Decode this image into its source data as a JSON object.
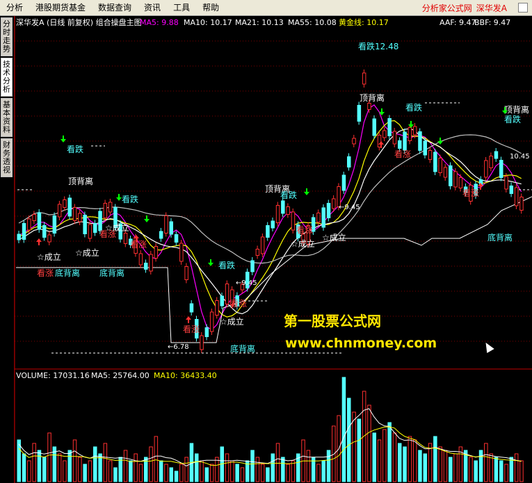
{
  "menu": {
    "items": [
      "分析",
      "港股期货基金",
      "数据查询",
      "资讯",
      "工具",
      "帮助"
    ],
    "brand_site": "分析家公式网",
    "stock_name_right": "深华发A"
  },
  "sidebar": {
    "tabs": [
      "分时走势",
      "技术分析",
      "基本资料",
      "财务透视"
    ]
  },
  "main_chart": {
    "title": "深华发A (日线 前复权) 组合操盘主图",
    "ma_readouts": [
      {
        "label": "MA5: 9.88",
        "color": "#FF00FF"
      },
      {
        "label": "MA10: 10.17",
        "color": "#FFFFFF"
      },
      {
        "label": "MA21: 10.13",
        "color": "#FFFFFF"
      },
      {
        "label": "MA55: 10.08",
        "color": "#FFFFFF"
      },
      {
        "label": "黄金线: 10.17",
        "color": "#FFFF00"
      },
      {
        "label": "AAF: 9.47",
        "color": "#FFFFFF"
      },
      {
        "label": "BBF: 9.47",
        "color": "#FFFFFF"
      }
    ],
    "price_annotations": {
      "high": "12.48",
      "low": "6.78",
      "mid1": "9.45",
      "mid2": "9.45",
      "right_level": "10.45"
    },
    "signals": {
      "bearish": "看跌",
      "bullish": "看涨",
      "top_divergence": "顶背离",
      "bottom_divergence": "底背离",
      "confirmed": "☆成立"
    }
  },
  "volume_chart": {
    "volume": "VOLUME: 17031.16",
    "ma5": "MA5: 25764.00",
    "ma10": "MA10: 36433.40"
  },
  "watermark": {
    "line1": "第一股票公式网",
    "line2": "www.chnmoney.com"
  },
  "colors": {
    "up": "#FF3030",
    "down": "#54FFFF",
    "ma5": "#FF00FF",
    "gold": "#FFFF00",
    "grid": "#800000",
    "accent_green": "#00FF00"
  },
  "icons": [
    "down-arrow-icon",
    "up-arrow-icon",
    "cursor-arrow-icon",
    "maximize-icon"
  ]
}
